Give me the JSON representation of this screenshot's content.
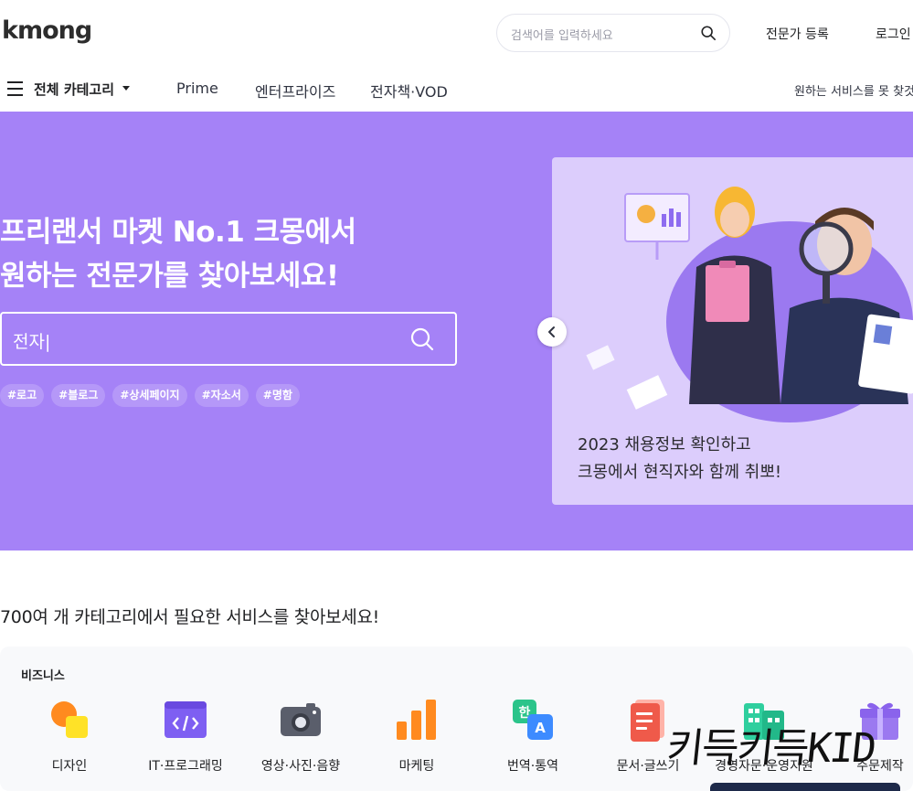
{
  "header": {
    "logo": "kmong",
    "search_placeholder": "검색어를 입력하세요",
    "expert_register": "전문가 등록",
    "login": "로그인"
  },
  "nav": {
    "all_categories": "전체 카테고리",
    "items": [
      "Prime",
      "엔터프라이즈",
      "전자책·VOD"
    ],
    "right_text": "원하는 서비스를 못 찾것"
  },
  "hero": {
    "title_line1": "프리랜서 마켓 No.1 크몽에서",
    "title_line2": "원하는 전문가를 찾아보세요!",
    "search_value": "전자|",
    "tags": [
      "#로고",
      "#블로그",
      "#상세페이지",
      "#자소서",
      "#명함"
    ],
    "banner_line1": "2023 채용정보 확인하고",
    "banner_line2": "크몽에서 현직자와 함께 취뽀!",
    "accent_color": "#a582f7"
  },
  "categories": {
    "section_title": "700여 개 카테고리에서 필요한 서비스를 찾아보세요!",
    "group_title": "비즈니스",
    "items": [
      {
        "label": "디자인",
        "icon": "design-icon"
      },
      {
        "label": "IT·프로그래밍",
        "icon": "code-icon"
      },
      {
        "label": "영상·사진·음향",
        "icon": "camera-icon"
      },
      {
        "label": "마케팅",
        "icon": "bar-chart-icon"
      },
      {
        "label": "번역·통역",
        "icon": "translate-icon"
      },
      {
        "label": "문서·글쓰기",
        "icon": "document-icon"
      },
      {
        "label": "경영자문·운영지원",
        "icon": "building-icon"
      },
      {
        "label": "주문제작",
        "icon": "gift-icon"
      }
    ]
  },
  "overlay": {
    "watermark": "키득키득KID"
  }
}
